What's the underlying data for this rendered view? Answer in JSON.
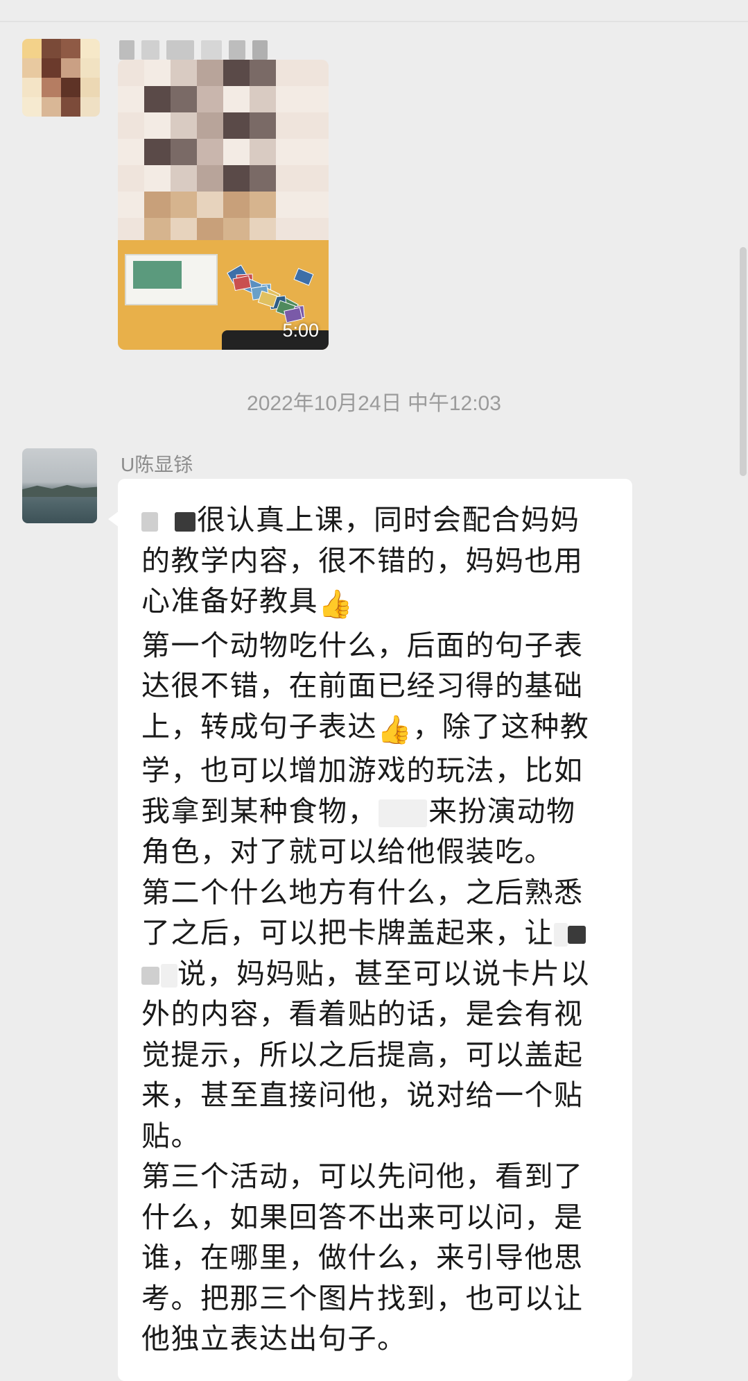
{
  "messages": {
    "video": {
      "duration": "5:00"
    },
    "timestamp": "2022年10月24日 中午12:03",
    "text_message": {
      "sender": "U陈显铩",
      "lines": [
        "很认真上课，同时会配合妈妈",
        "的教学内容，很不错的，妈妈也用",
        "心准备好教具",
        "第一个动物吃什么，后面的句子表",
        "达很不错，在前面已经习得的基础",
        "上，转成句子表达",
        "，除了这种教",
        "学，也可以增加游戏的玩法，比如",
        "我拿到某种食物，",
        "来扮演动物",
        "角色，对了就可以给他假装吃。",
        "第二个什么地方有什么，之后熟悉",
        "了之后，可以把卡牌盖起来，让",
        "说，妈妈贴，甚至可以说卡片以",
        "外的内容，看着贴的话，是会有视",
        "觉提示，所以之后提高，可以盖起",
        "来，甚至直接问他，说对给一个贴",
        "贴。",
        "第三个活动，可以先问他，看到了",
        "什么，如果回答不出来可以问，是",
        "谁，在哪里，做什么，来引导他思",
        "考。把那三个图片找到，也可以让",
        "他独立表达出句子。"
      ],
      "emoji": "👍"
    }
  },
  "colors": {
    "background": "#ededed",
    "bubble": "#ffffff",
    "timestamp": "#9b9b9b",
    "sender_name": "#8c8c8c",
    "text": "#1a1a1a"
  },
  "icons": {
    "thumbs_up": "thumbs-up-icon"
  }
}
